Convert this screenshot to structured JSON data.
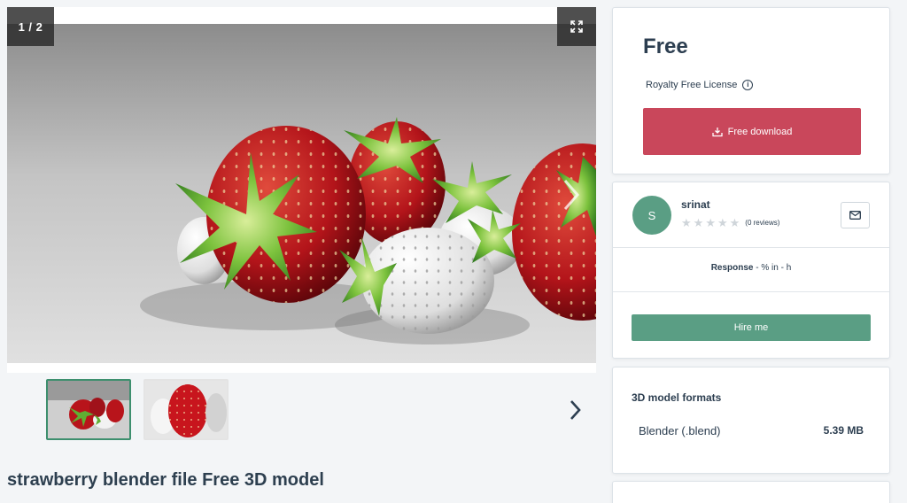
{
  "gallery": {
    "counter": "1 / 2",
    "fullscreen_icon": "expand-icon",
    "next_icon": "chevron-right-icon",
    "thumbnails": [
      {
        "alt": "strawberries scene",
        "active": true
      },
      {
        "alt": "single strawberry close-up",
        "active": false
      }
    ]
  },
  "model": {
    "title": "strawberry blender file Free 3D model"
  },
  "pricing": {
    "price": "Free",
    "license": "Royalty Free License",
    "download_label": "Free download"
  },
  "author": {
    "avatar_initial": "S",
    "name": "srinat",
    "rating": 0,
    "reviews": "(0 reviews)",
    "response_label": "Response",
    "response_value": " - % in - h",
    "hire_label": "Hire me"
  },
  "formats": {
    "heading": "3D model formats",
    "items": [
      {
        "name": "Blender (.blend)",
        "size": "5.39 MB"
      }
    ]
  },
  "colors": {
    "download": "#c9475b",
    "accent_green": "#5a9e84",
    "text": "#2c3e50",
    "background": "#f3f5f7"
  }
}
